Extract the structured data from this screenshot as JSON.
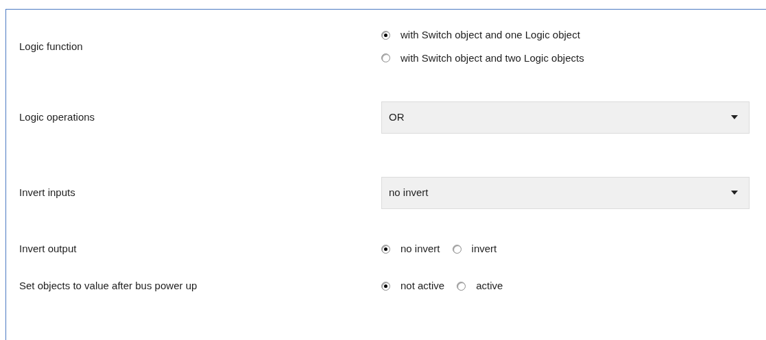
{
  "rows": [
    {
      "label": "Logic function",
      "kind": "radio-stack",
      "options": [
        {
          "label": "with Switch object and one Logic object",
          "selected": true
        },
        {
          "label": "with Switch object and two Logic objects",
          "selected": false
        }
      ]
    },
    {
      "label": "Logic operations",
      "kind": "dropdown",
      "value": "OR"
    },
    {
      "label": "Invert inputs",
      "kind": "dropdown",
      "value": "no invert"
    },
    {
      "label": "Invert output",
      "kind": "radio-inline",
      "options": [
        {
          "label": "no invert",
          "selected": true
        },
        {
          "label": "invert",
          "selected": false
        }
      ]
    },
    {
      "label": "Set objects to value after bus power up",
      "kind": "radio-inline",
      "options": [
        {
          "label": "not active",
          "selected": true
        },
        {
          "label": "active",
          "selected": false
        }
      ]
    }
  ]
}
